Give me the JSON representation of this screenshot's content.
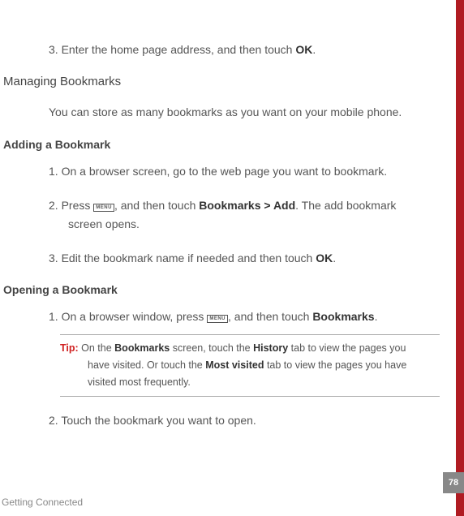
{
  "menu_label": "MENU",
  "intro_step": {
    "num": "3.",
    "pre": " Enter the home page address, and then touch ",
    "bold": "OK",
    "post": "."
  },
  "section1": {
    "title": "Managing  Bookmarks",
    "body": "You can store as many bookmarks as you want on your mobile phone."
  },
  "section2": {
    "title": "Adding a Bookmark",
    "steps": {
      "s1": {
        "num": "1.",
        "text": " On a browser screen, go to the web page you want to bookmark."
      },
      "s2": {
        "num": "2.",
        "pre": " Press ",
        "mid": ", and then touch ",
        "bold": "Bookmarks > Add",
        "post": ". The add bookmark ",
        "cont": "screen opens."
      },
      "s3": {
        "num": "3.",
        "pre": " Edit the bookmark name if needed and then touch ",
        "bold": "OK",
        "post": "."
      }
    }
  },
  "section3": {
    "title": "Opening a Bookmark",
    "steps": {
      "s1": {
        "num": "1.",
        "pre": " On a browser window, press ",
        "mid": ", and then touch ",
        "bold": "Bookmarks",
        "post": "."
      },
      "s2": {
        "num": "2.",
        "text": " Touch the bookmark you want to open."
      }
    },
    "tip": {
      "label": "Tip:  ",
      "t1a": "On the ",
      "t1b": "Bookmarks",
      "t1c": " screen, touch the ",
      "t1d": "History",
      "t1e": " tab to view the pages you ",
      "t2a": "have visited. Or touch the ",
      "t2b": "Most visited",
      "t2c": " tab to view the pages you have ",
      "t3": "visited most frequently."
    }
  },
  "footer": {
    "chapter": "Getting Connected",
    "page": "78"
  }
}
